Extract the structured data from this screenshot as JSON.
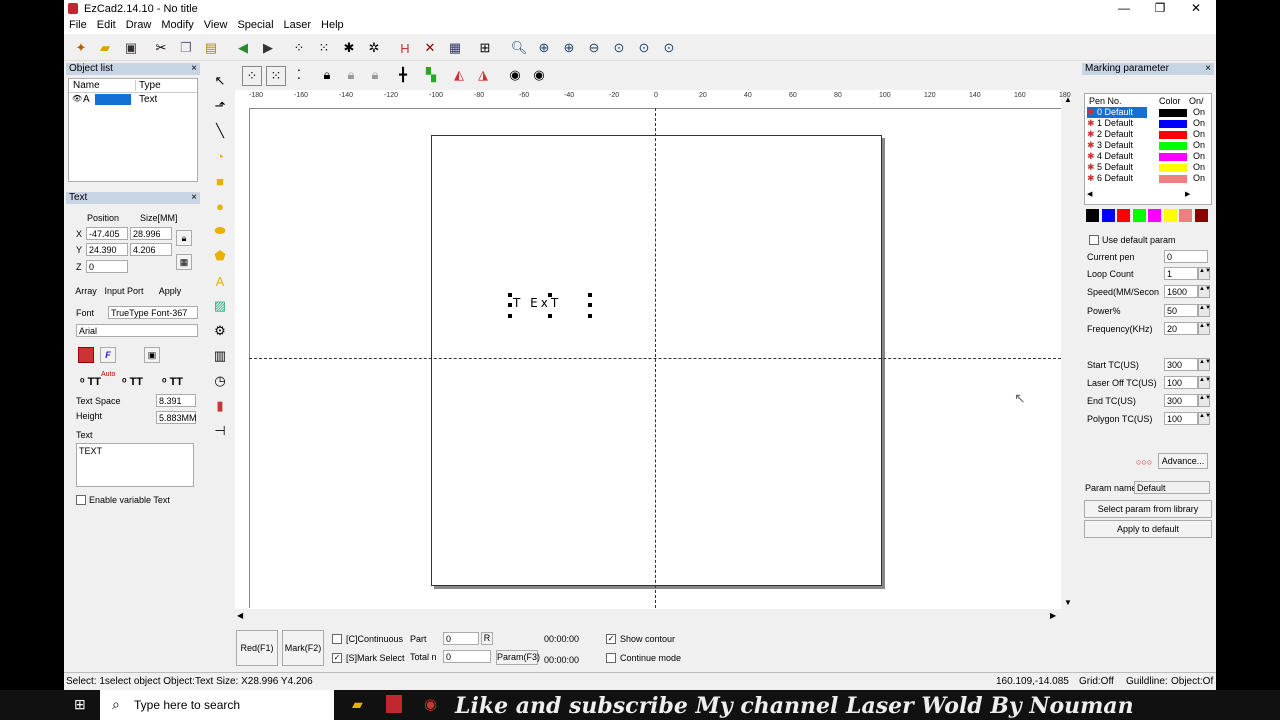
{
  "window": {
    "title": "EzCad2.14.10 - No title",
    "min": "—",
    "max": "❐",
    "close": "✕"
  },
  "menu": [
    "File",
    "Edit",
    "Draw",
    "Modify",
    "View",
    "Special",
    "Laser",
    "Help"
  ],
  "object_list": {
    "title": "Object list",
    "close": "×",
    "col_name": "Name",
    "col_type": "Type",
    "rows": [
      {
        "name": "A",
        "type": "Text"
      }
    ]
  },
  "text_panel": {
    "title": "Text",
    "close": "×",
    "position_label": "Position",
    "size_label": "Size[MM]",
    "x_label": "X",
    "y_label": "Y",
    "z_label": "Z",
    "x_pos": "-47.405",
    "x_size": "28.996",
    "y_pos": "24.390",
    "y_size": "4.206",
    "z_pos": "0",
    "array": "Array",
    "input_port": "Input Port",
    "apply": "Apply",
    "font_label": "Font",
    "font_type": "TrueType Font-367",
    "font_name": "Arial",
    "auto_label": "Auto",
    "text_space_label": "Text Space",
    "text_space": "8.391",
    "height_label": "Height",
    "height": "5.883MM",
    "text_label": "Text",
    "text_value": "TEXT",
    "enable_variable": "Enable variable Text"
  },
  "canvas": {
    "ruler_ticks": [
      "-180",
      "-160",
      "-140",
      "-120",
      "-100",
      "-80",
      "-60",
      "-40",
      "-20",
      "0",
      "20",
      "40",
      "60",
      "80",
      "100",
      "120",
      "140",
      "160",
      "180"
    ],
    "object_text": "T ExT"
  },
  "marking": {
    "title": "Marking parameter",
    "close": "×",
    "col_pen": "Pen No.",
    "col_color": "Color",
    "col_on": "On/",
    "pens": [
      {
        "name": "0 Default",
        "color": "#000000",
        "on": "On"
      },
      {
        "name": "1 Default",
        "color": "#0000ff",
        "on": "On"
      },
      {
        "name": "2 Default",
        "color": "#ff0000",
        "on": "On"
      },
      {
        "name": "3 Default",
        "color": "#00ff00",
        "on": "On"
      },
      {
        "name": "4 Default",
        "color": "#ff00ff",
        "on": "On"
      },
      {
        "name": "5 Default",
        "color": "#ffff00",
        "on": "On"
      },
      {
        "name": "6 Default",
        "color": "#f08080",
        "on": "On"
      }
    ],
    "swatches": [
      "#000000",
      "#0000ff",
      "#ff0000",
      "#00ff00",
      "#ff00ff",
      "#ffff00",
      "#f08080",
      "#8b0000"
    ],
    "use_default": "Use default param",
    "current_pen_label": "Current pen",
    "current_pen": "0",
    "loop_label": "Loop Count",
    "loop": "1",
    "speed_label": "Speed(MM/Secon",
    "speed": "1600",
    "power_label": "Power%",
    "power": "50",
    "freq_label": "Frequency(KHz)",
    "freq": "20",
    "start_tc_label": "Start TC(US)",
    "start_tc": "300",
    "laser_off_label": "Laser Off TC(US)",
    "laser_off": "100",
    "end_tc_label": "End TC(US)",
    "end_tc": "300",
    "polygon_tc_label": "Polygon TC(US)",
    "polygon_tc": "100",
    "advance": "Advance...",
    "param_name_label": "Param name",
    "param_name": "Default",
    "select_lib": "Select param from library",
    "apply_default": "Apply to default"
  },
  "bottom": {
    "red": "Red(F1)",
    "mark": "Mark(F2)",
    "continuous": "[C]Continuous",
    "mark_select": "[S]Mark Select",
    "part_label": "Part",
    "part": "0",
    "r_btn": "R",
    "total_label": "Total n",
    "total": "0",
    "param_btn": "Param(F3)",
    "time1": "00:00:00",
    "time2": "00:00:00",
    "show_contour": "Show contour",
    "continue_mode": "Continue mode"
  },
  "status": {
    "left": "Select: 1select object Object:Text Size: X28.996 Y4.206",
    "coords": "160.109,-14.085",
    "grid": "Grid:Off",
    "guideline": "Guildline:",
    "object": "Object:Of"
  },
  "taskbar": {
    "search": "Type here to search",
    "banner": "Like  and subscribe My channel Laser Wold By Nouman"
  }
}
